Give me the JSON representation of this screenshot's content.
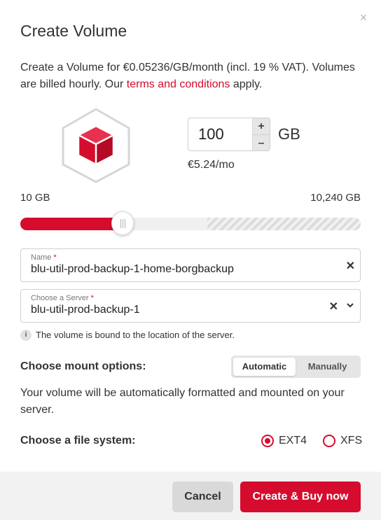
{
  "dialog": {
    "title": "Create Volume",
    "close_icon": "close-icon"
  },
  "intro": {
    "text_before": "Create a Volume for €0.05236/GB/month (incl. 19 % VAT). Volumes are billed hourly. Our ",
    "link": "terms and conditions",
    "text_after": " apply."
  },
  "volume_icon": "volume-cube-icon",
  "size": {
    "value": "100",
    "increment_label": "+",
    "decrement_label": "–",
    "unit": "GB",
    "price": "€5.24/mo"
  },
  "slider": {
    "min_label": "10 GB",
    "max_label": "10,240 GB",
    "fill_fraction": 0.3,
    "limit_fraction": 0.55
  },
  "name_field": {
    "label": "Name",
    "required_mark": "*",
    "value": "blu-util-prod-backup-1-home-borgbackup",
    "clear_label": "✕"
  },
  "server_field": {
    "label": "Choose a Server",
    "required_mark": "*",
    "value": "blu-util-prod-backup-1",
    "clear_label": "✕",
    "chevron_icon": "chevron-down-icon"
  },
  "info": {
    "icon_label": "i",
    "text": "The volume is bound to the location of the server."
  },
  "mount": {
    "label": "Choose mount options:",
    "options": [
      "Automatic",
      "Manually"
    ],
    "selected": "Automatic",
    "description": "Your volume will be automatically formatted and mounted on your server."
  },
  "filesystem": {
    "label": "Choose a file system:",
    "options": [
      "EXT4",
      "XFS"
    ],
    "selected": "EXT4"
  },
  "footer": {
    "cancel_label": "Cancel",
    "create_label": "Create & Buy now"
  },
  "colors": {
    "accent": "#d50c2d",
    "footer_bg": "#f2f2f2",
    "cancel_bg": "#d9d9d9"
  }
}
